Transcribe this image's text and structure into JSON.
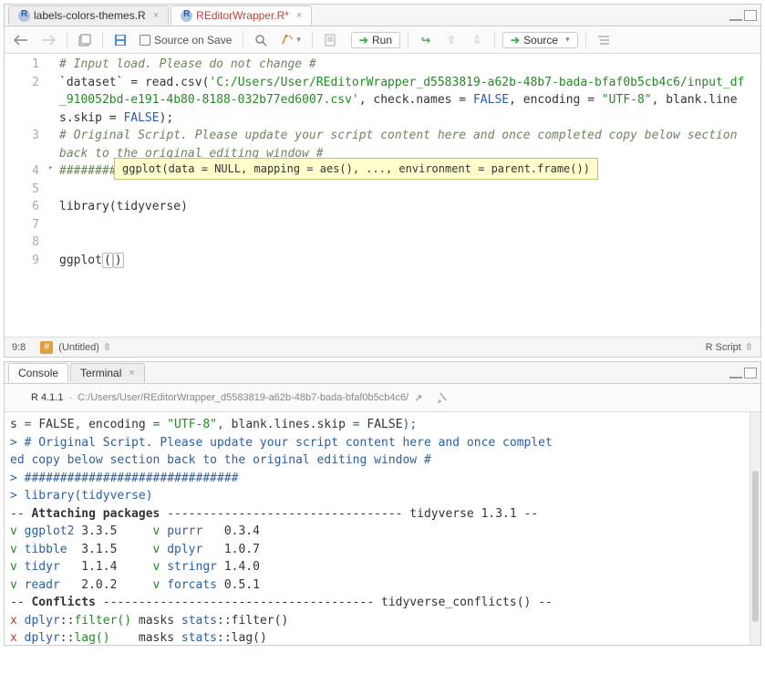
{
  "editor": {
    "tabs": [
      {
        "label": "labels-colors-themes.R",
        "active": false
      },
      {
        "label": "REditorWrapper.R*",
        "active": true
      }
    ],
    "sourceOnSave": "Source on Save",
    "runBtn": "Run",
    "sourceBtn": "Source",
    "tooltip": "ggplot(data = NULL, mapping = aes(), ..., environment = parent.frame())",
    "statusPos": "9:8",
    "statusDoc": "(Untitled)",
    "statusLang": "R Script",
    "lines": [
      {
        "n": "1",
        "fold": "",
        "frags": [
          {
            "cls": "kw-comment",
            "t": "# Input load. Please do not change #"
          }
        ]
      },
      {
        "n": "2",
        "fold": "",
        "frags": [
          {
            "cls": "kw-id",
            "t": "`dataset`"
          },
          {
            "cls": "kw-op",
            "t": " = "
          },
          {
            "cls": "kw-fn",
            "t": "read.csv"
          },
          {
            "cls": "kw-op",
            "t": "("
          },
          {
            "cls": "kw-string",
            "t": "'C:/Users/User/REditorWrapper_d5583819-a62b-48b7-bada-bfaf0b5cb4c6/input_df_910052bd-e191-4b80-8188-032b77ed6007.csv'"
          },
          {
            "cls": "kw-op",
            "t": ", check.names = "
          },
          {
            "cls": "kw-const",
            "t": "FALSE"
          },
          {
            "cls": "kw-op",
            "t": ", encoding = "
          },
          {
            "cls": "kw-string",
            "t": "\"UTF-8\""
          },
          {
            "cls": "kw-op",
            "t": ", blank.lines.skip = "
          },
          {
            "cls": "kw-const",
            "t": "FALSE"
          },
          {
            "cls": "kw-op",
            "t": ");"
          }
        ]
      },
      {
        "n": "3",
        "fold": "",
        "frags": [
          {
            "cls": "kw-comment",
            "t": "# Original Script. Please update your script content here and once completed copy below section back to the original editing window #"
          }
        ]
      },
      {
        "n": "4",
        "fold": "▸",
        "frags": [
          {
            "cls": "kw-comment",
            "t": "##############################"
          }
        ]
      },
      {
        "n": "5",
        "fold": "",
        "frags": []
      },
      {
        "n": "6",
        "fold": "",
        "frags": [
          {
            "cls": "kw-fn",
            "t": "library"
          },
          {
            "cls": "kw-op",
            "t": "(tidyverse)"
          }
        ]
      },
      {
        "n": "7",
        "fold": "",
        "frags": []
      },
      {
        "n": "8",
        "fold": "",
        "frags": []
      },
      {
        "n": "9",
        "fold": "",
        "frags": [
          {
            "cls": "kw-fn",
            "t": "ggplot"
          },
          {
            "cls": "bracket-hl",
            "t": "("
          },
          {
            "cls": "bracket-hl",
            "t": ")"
          }
        ]
      }
    ]
  },
  "console": {
    "tabs": [
      "Console",
      "Terminal"
    ],
    "version": "R 4.1.1",
    "path": "C:/Users/User/REditorWrapper_d5583819-a62b-48b7-bada-bfaf0b5cb4c6/",
    "lines": [
      [
        {
          "c": "c-black",
          "t": "s "
        },
        {
          "c": "c-blue",
          "t": "= "
        },
        {
          "c": "c-black",
          "t": "FALSE"
        },
        {
          "c": "c-blue",
          "t": ", "
        },
        {
          "c": "c-black",
          "t": "encoding "
        },
        {
          "c": "c-blue",
          "t": "= "
        },
        {
          "c": "c-green",
          "t": "\"UTF-8\""
        },
        {
          "c": "c-blue",
          "t": ", "
        },
        {
          "c": "c-black",
          "t": "blank.lines.skip "
        },
        {
          "c": "c-blue",
          "t": "= "
        },
        {
          "c": "c-black",
          "t": "FALSE"
        },
        {
          "c": "c-blue",
          "t": ");"
        }
      ],
      [
        {
          "c": "c-blue",
          "t": "> "
        },
        {
          "c": "c-blue",
          "t": "# Original Script. Please update your script content here and once complet"
        }
      ],
      [
        {
          "c": "c-blue",
          "t": "ed copy below section back to the original editing window #"
        }
      ],
      [
        {
          "c": "c-blue",
          "t": "> "
        },
        {
          "c": "c-blue",
          "t": "##############################"
        }
      ],
      [
        {
          "c": "c-blue",
          "t": "> "
        },
        {
          "c": "c-blue",
          "t": "library"
        },
        {
          "c": "c-blue",
          "t": "("
        },
        {
          "c": "c-blue",
          "t": "tidyverse"
        },
        {
          "c": "c-blue",
          "t": ")"
        }
      ],
      [
        {
          "c": "c-black",
          "t": "-- "
        },
        {
          "c": "c-black c-bold",
          "t": "Attaching packages"
        },
        {
          "c": "c-black",
          "t": " --------------------------------- tidyverse 1.3.1 --"
        }
      ],
      [
        {
          "c": "c-green",
          "t": "v "
        },
        {
          "c": "c-blue",
          "t": "ggplot2"
        },
        {
          "c": "c-black",
          "t": " 3.3.5     "
        },
        {
          "c": "c-green",
          "t": "v "
        },
        {
          "c": "c-blue",
          "t": "purrr  "
        },
        {
          "c": "c-black",
          "t": " 0.3.4"
        }
      ],
      [
        {
          "c": "c-green",
          "t": "v "
        },
        {
          "c": "c-blue",
          "t": "tibble "
        },
        {
          "c": "c-black",
          "t": " 3.1.5     "
        },
        {
          "c": "c-green",
          "t": "v "
        },
        {
          "c": "c-blue",
          "t": "dplyr  "
        },
        {
          "c": "c-black",
          "t": " 1.0.7"
        }
      ],
      [
        {
          "c": "c-green",
          "t": "v "
        },
        {
          "c": "c-blue",
          "t": "tidyr  "
        },
        {
          "c": "c-black",
          "t": " 1.1.4     "
        },
        {
          "c": "c-green",
          "t": "v "
        },
        {
          "c": "c-blue",
          "t": "stringr"
        },
        {
          "c": "c-black",
          "t": " 1.4.0"
        }
      ],
      [
        {
          "c": "c-green",
          "t": "v "
        },
        {
          "c": "c-blue",
          "t": "readr  "
        },
        {
          "c": "c-black",
          "t": " 2.0.2     "
        },
        {
          "c": "c-green",
          "t": "v "
        },
        {
          "c": "c-blue",
          "t": "forcats"
        },
        {
          "c": "c-black",
          "t": " 0.5.1"
        }
      ],
      [
        {
          "c": "c-black",
          "t": "-- "
        },
        {
          "c": "c-black c-bold",
          "t": "Conflicts"
        },
        {
          "c": "c-black",
          "t": " -------------------------------------- tidyverse_conflicts() --"
        }
      ],
      [
        {
          "c": "c-red",
          "t": "x "
        },
        {
          "c": "c-blue",
          "t": "dplyr"
        },
        {
          "c": "c-black",
          "t": "::"
        },
        {
          "c": "c-green",
          "t": "filter()"
        },
        {
          "c": "c-black",
          "t": " masks "
        },
        {
          "c": "c-blue",
          "t": "stats"
        },
        {
          "c": "c-black",
          "t": "::filter()"
        }
      ],
      [
        {
          "c": "c-red",
          "t": "x "
        },
        {
          "c": "c-blue",
          "t": "dplyr"
        },
        {
          "c": "c-black",
          "t": "::"
        },
        {
          "c": "c-green",
          "t": "lag()"
        },
        {
          "c": "c-black",
          "t": "    masks "
        },
        {
          "c": "c-blue",
          "t": "stats"
        },
        {
          "c": "c-black",
          "t": "::lag()"
        }
      ],
      [
        {
          "c": "c-blue",
          "t": "> "
        }
      ]
    ]
  }
}
